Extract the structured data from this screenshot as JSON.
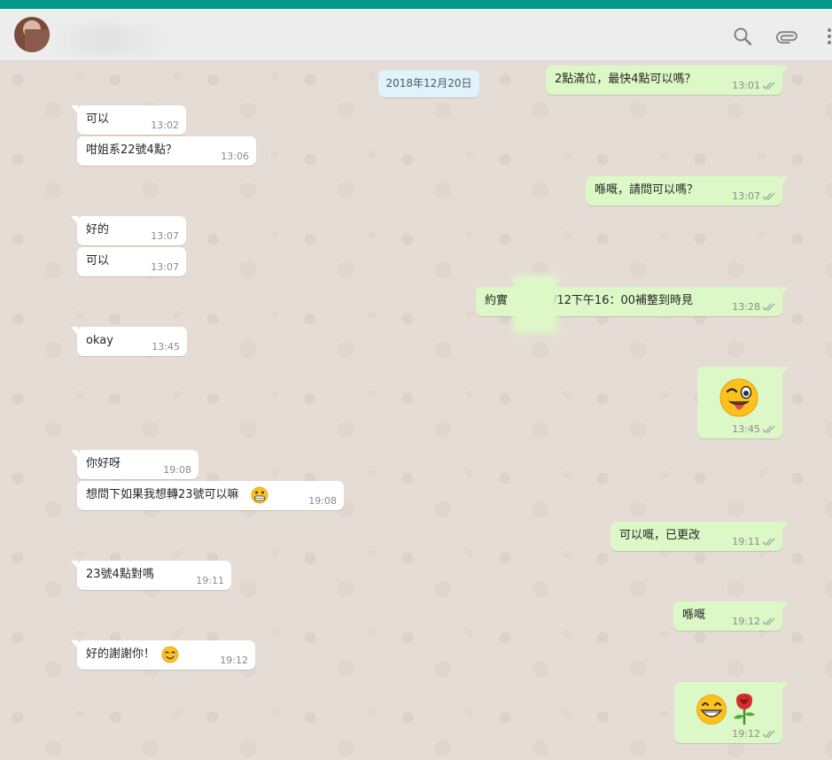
{
  "header": {
    "search_icon": "search-icon",
    "attach_icon": "paperclip-icon",
    "menu_icon": "kebab-menu-icon"
  },
  "date_label": "2018年12月20日",
  "messages": [
    {
      "dir": "out",
      "text": "2點滿位，最快4點可以嗎？",
      "time": "13:01"
    },
    {
      "dir": "in",
      "text": "可以",
      "time": "13:02"
    },
    {
      "dir": "in",
      "text": "咁姐系22號4點？",
      "time": "13:06"
    },
    {
      "dir": "out",
      "text": "喺嘅，請問可以嗎？",
      "time": "13:07"
    },
    {
      "dir": "in",
      "text": "好的",
      "time": "13:07"
    },
    {
      "dir": "in",
      "text": "可以",
      "time": "13:07"
    },
    {
      "dir": "out",
      "text_before": "約實",
      "text_after": "/12下午16：00補整到時見",
      "time": "13:28"
    },
    {
      "dir": "in",
      "text": "okay",
      "time": "13:45"
    },
    {
      "dir": "out",
      "emoji": "winking-face-with-tongue",
      "time": "13:45"
    },
    {
      "dir": "in",
      "text": "你好呀",
      "time": "19:08"
    },
    {
      "dir": "in",
      "text": "想問下如果我想轉23號可以嘛",
      "emoji": "grimacing-face",
      "time": "19:08"
    },
    {
      "dir": "out",
      "text": "可以嘅，已更改",
      "time": "19:11"
    },
    {
      "dir": "in",
      "text": "23號4點對嗎",
      "time": "19:11"
    },
    {
      "dir": "out",
      "text": "喺嘅",
      "time": "19:12"
    },
    {
      "dir": "in",
      "text": "好的謝謝你！",
      "emoji": "smiling-face",
      "time": "19:12"
    },
    {
      "dir": "out",
      "emoji": "grinning-face, rose",
      "time": "19:12"
    }
  ],
  "colors": {
    "top_bar": "#009688",
    "header_bg": "#ededed",
    "chat_bg": "#e5ddd5",
    "incoming_bubble": "#ffffff",
    "outgoing_bubble": "#dcf8c6",
    "date_chip": "#e1f2fb",
    "read_ticks": "#9aa5a0"
  }
}
